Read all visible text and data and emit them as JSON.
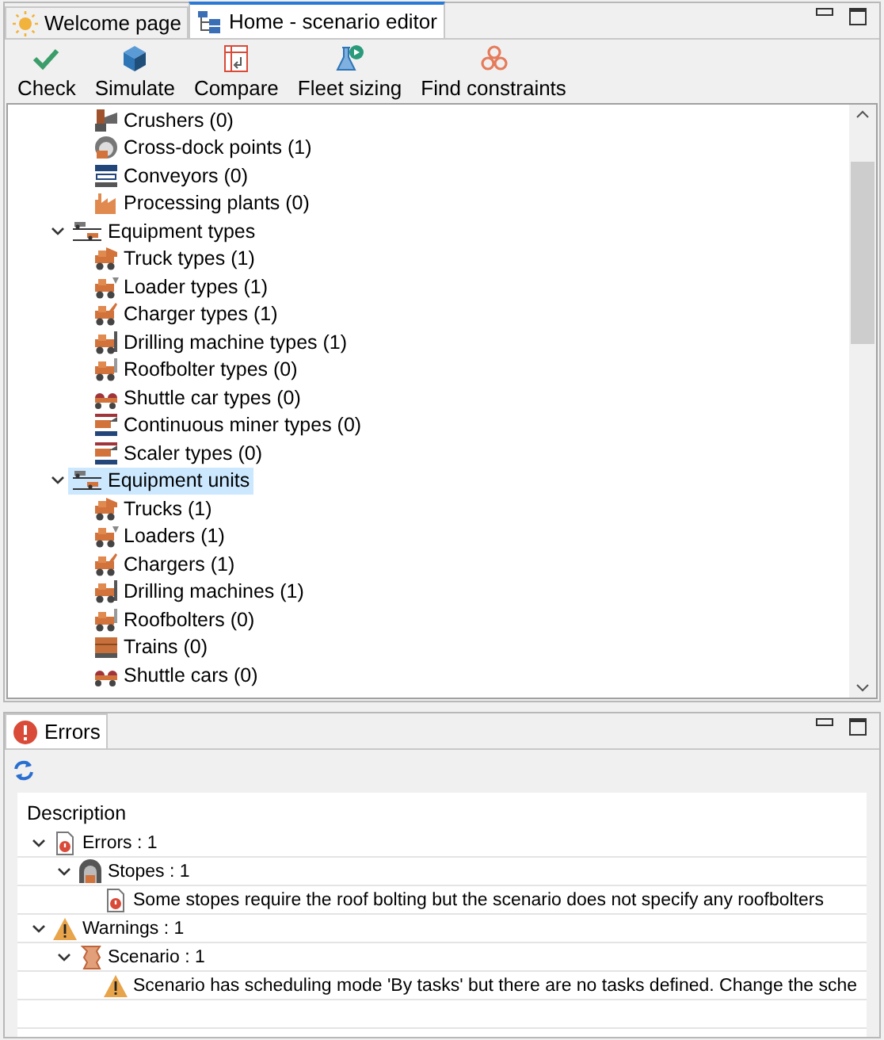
{
  "editor_tabs": [
    {
      "label": "Welcome page",
      "kind": "sun",
      "selected": false
    },
    {
      "label": "Home - scenario editor",
      "kind": "tree",
      "selected": true
    }
  ],
  "toolbar": [
    {
      "label": "Check",
      "kind": "check"
    },
    {
      "label": "Simulate",
      "kind": "cube"
    },
    {
      "label": "Compare",
      "kind": "compare"
    },
    {
      "label": "Fleet sizing",
      "kind": "flask"
    },
    {
      "label": "Find constraints",
      "kind": "knot"
    }
  ],
  "tree": [
    {
      "label": "Crushers (0)",
      "kind": "crusher",
      "selected": false
    },
    {
      "label": "Cross-dock points (1)",
      "kind": "crossdock",
      "selected": false
    },
    {
      "label": "Conveyors (0)",
      "kind": "conveyor",
      "selected": false
    },
    {
      "label": "Processing plants (0)",
      "kind": "plant",
      "selected": false
    },
    {
      "label": "Equipment types",
      "kind": "group",
      "selected": false,
      "expanded": true,
      "children": [
        {
          "label": "Truck types (1)",
          "kind": "truck",
          "selected": false
        },
        {
          "label": "Loader types (1)",
          "kind": "loader",
          "selected": false
        },
        {
          "label": "Charger types (1)",
          "kind": "charger",
          "selected": false
        },
        {
          "label": "Drilling machine types (1)",
          "kind": "drill",
          "selected": false
        },
        {
          "label": "Roofbolter types (0)",
          "kind": "roofbolter",
          "selected": false
        },
        {
          "label": "Shuttle car types (0)",
          "kind": "shuttle",
          "selected": false
        },
        {
          "label": "Continuous miner types (0)",
          "kind": "miner",
          "selected": false
        },
        {
          "label": "Scaler types (0)",
          "kind": "miner",
          "selected": false
        }
      ]
    },
    {
      "label": "Equipment units",
      "kind": "group",
      "selected": true,
      "expanded": true,
      "children": [
        {
          "label": "Trucks (1)",
          "kind": "truck",
          "selected": false
        },
        {
          "label": "Loaders (1)",
          "kind": "loader",
          "selected": false
        },
        {
          "label": "Chargers (1)",
          "kind": "charger",
          "selected": false
        },
        {
          "label": "Drilling machines (1)",
          "kind": "drill",
          "selected": false
        },
        {
          "label": "Roofbolters (0)",
          "kind": "roofbolter",
          "selected": false
        },
        {
          "label": "Trains (0)",
          "kind": "train",
          "selected": false
        },
        {
          "label": "Shuttle cars (0)",
          "kind": "shuttle",
          "selected": false
        }
      ]
    }
  ],
  "errors_view": {
    "tab": {
      "label": "Errors",
      "selected": true
    },
    "column": "Description",
    "rows": [
      {
        "label": "Errors : 1",
        "kind": "errorfile",
        "expanded": true,
        "children": [
          {
            "label": "Stopes : 1",
            "kind": "stope",
            "expanded": true,
            "children": [
              {
                "label": "Some stopes require the roof bolting but the scenario does not specify any roofbolters",
                "kind": "errorfile"
              }
            ]
          }
        ]
      },
      {
        "label": "Warnings : 1",
        "kind": "warning",
        "expanded": true,
        "children": [
          {
            "label": "Scenario : 1",
            "kind": "scroll",
            "expanded": true,
            "children": [
              {
                "label": "Scenario has scheduling mode 'By tasks' but there are no tasks defined. Change the sche",
                "kind": "warning"
              }
            ]
          }
        ]
      }
    ]
  }
}
